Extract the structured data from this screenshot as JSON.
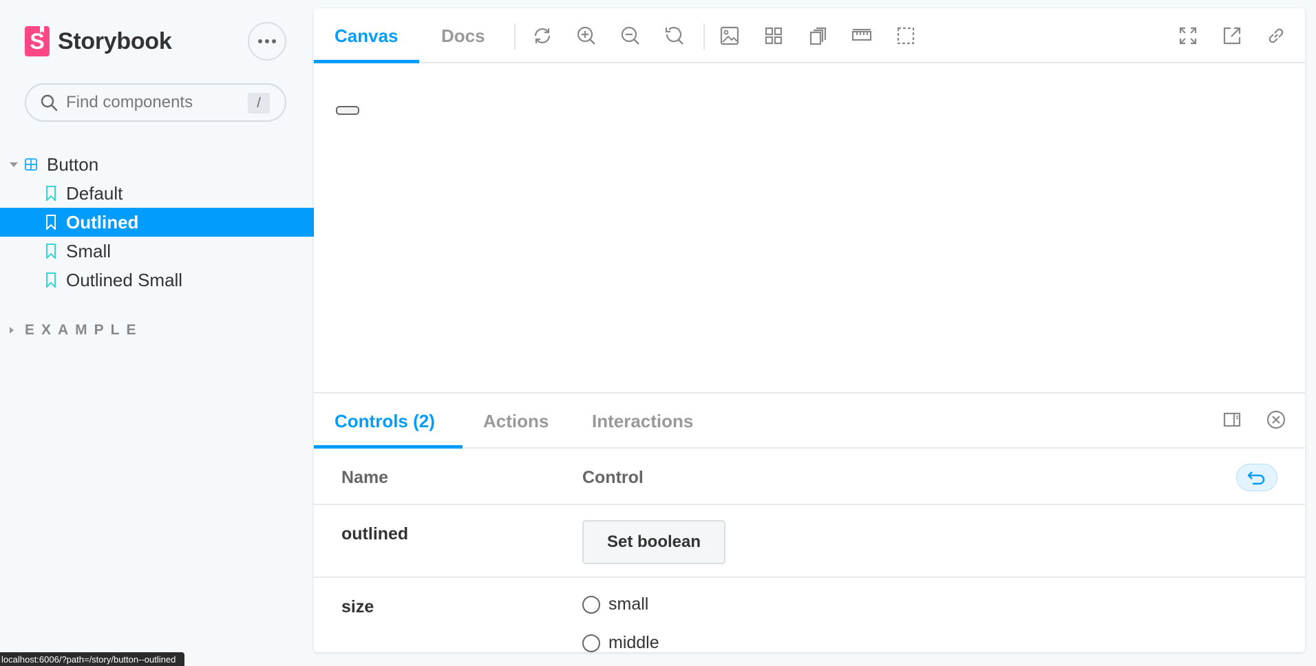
{
  "brand": {
    "logo_letter": "S",
    "name": "Storybook"
  },
  "search": {
    "placeholder": "Find components",
    "shortcut": "/"
  },
  "tree": {
    "group": "Button",
    "items": [
      {
        "label": "Default",
        "active": false
      },
      {
        "label": "Outlined",
        "active": true
      },
      {
        "label": "Small",
        "active": false
      },
      {
        "label": "Outlined Small",
        "active": false
      }
    ],
    "section": "EXAMPLE"
  },
  "toolbar": {
    "tabs": [
      "Canvas",
      "Docs"
    ],
    "active_tab": "Canvas",
    "tool_icons": [
      "sync-icon",
      "zoom-in-icon",
      "zoom-out-icon",
      "zoom-reset-icon",
      "background-image-icon",
      "grid-icon",
      "viewport-icon",
      "measure-icon",
      "outline-icon",
      "fullscreen-icon",
      "open-new-tab-icon",
      "copy-link-icon"
    ]
  },
  "addons": {
    "tabs": [
      "Controls (2)",
      "Actions",
      "Interactions"
    ],
    "active_tab": "Controls (2)",
    "table": {
      "headers": {
        "name": "Name",
        "control": "Control"
      },
      "rows": [
        {
          "name": "outlined",
          "control_label": "Set boolean"
        },
        {
          "name": "size",
          "options": [
            "small",
            "middle"
          ]
        }
      ]
    }
  },
  "statusbar": {
    "url": "localhost:6006/?path=/story/button--outlined"
  },
  "colors": {
    "accent": "#029cfd",
    "brand": "#ff4785",
    "active_bg": "#029cfd",
    "story_icon": "#1ea7fd"
  }
}
